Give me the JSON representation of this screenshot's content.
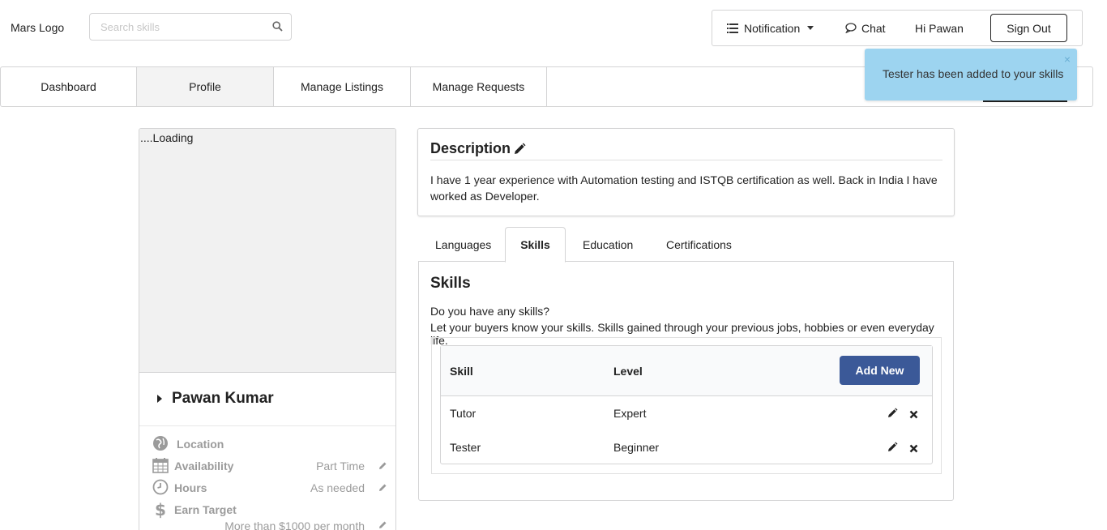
{
  "header": {
    "logo": "Mars Logo",
    "search_placeholder": "Search skills",
    "notification_label": "Notification",
    "chat_label": "Chat",
    "greeting": "Hi Pawan",
    "signout_label": "Sign Out"
  },
  "nav": {
    "tabs": [
      "Dashboard",
      "Profile",
      "Manage Listings",
      "Manage Requests"
    ],
    "active": "Profile"
  },
  "toast": {
    "message": "Tester has been added to your skills",
    "close": "×"
  },
  "profile": {
    "loading": "....Loading",
    "name": "Pawan Kumar",
    "details": [
      {
        "label": "Location",
        "value": "",
        "icon": "globe-icon"
      },
      {
        "label": "Availability",
        "value": "Part Time",
        "icon": "calendar-icon"
      },
      {
        "label": "Hours",
        "value": "As needed",
        "icon": "clock-icon"
      },
      {
        "label": "Earn Target",
        "value": "More than $1000 per month",
        "icon": "dollar-icon"
      }
    ]
  },
  "description": {
    "title": "Description",
    "text": "I have 1 year experience with Automation testing and ISTQB certification as well. Back in India I have worked as Developer."
  },
  "tabs": {
    "items": [
      "Languages",
      "Skills",
      "Education",
      "Certifications"
    ],
    "active": "Skills"
  },
  "skills": {
    "title": "Skills",
    "question": "Do you have any skills?",
    "hint": "Let your buyers know your skills. Skills gained through your previous jobs, hobbies or even everyday life.",
    "col_skill": "Skill",
    "col_level": "Level",
    "add_label": "Add New",
    "rows": [
      {
        "skill": "Tutor",
        "level": "Expert"
      },
      {
        "skill": "Tester",
        "level": "Beginner"
      }
    ]
  },
  "colors": {
    "primary_button": "#3b5998",
    "toast_bg": "#9dd4f0"
  }
}
